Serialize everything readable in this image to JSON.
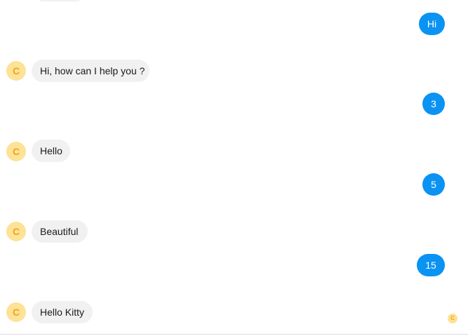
{
  "avatar_letter": "C",
  "seen_indicator_letter": "C",
  "colors": {
    "user_bubble": "#0a93f2",
    "bot_bubble": "#f1f1f1",
    "avatar_bg": "#fde297",
    "avatar_letter": "#f0a514"
  },
  "messages": [
    {
      "sender": "user",
      "text": "Hi"
    },
    {
      "sender": "bot",
      "text": "Hi, how can I help you ?"
    },
    {
      "sender": "user",
      "text": "3"
    },
    {
      "sender": "bot",
      "text": "Hello"
    },
    {
      "sender": "user",
      "text": "5"
    },
    {
      "sender": "bot",
      "text": "Beautiful"
    },
    {
      "sender": "user",
      "text": "15"
    },
    {
      "sender": "bot",
      "text": "Hello Kitty"
    }
  ]
}
